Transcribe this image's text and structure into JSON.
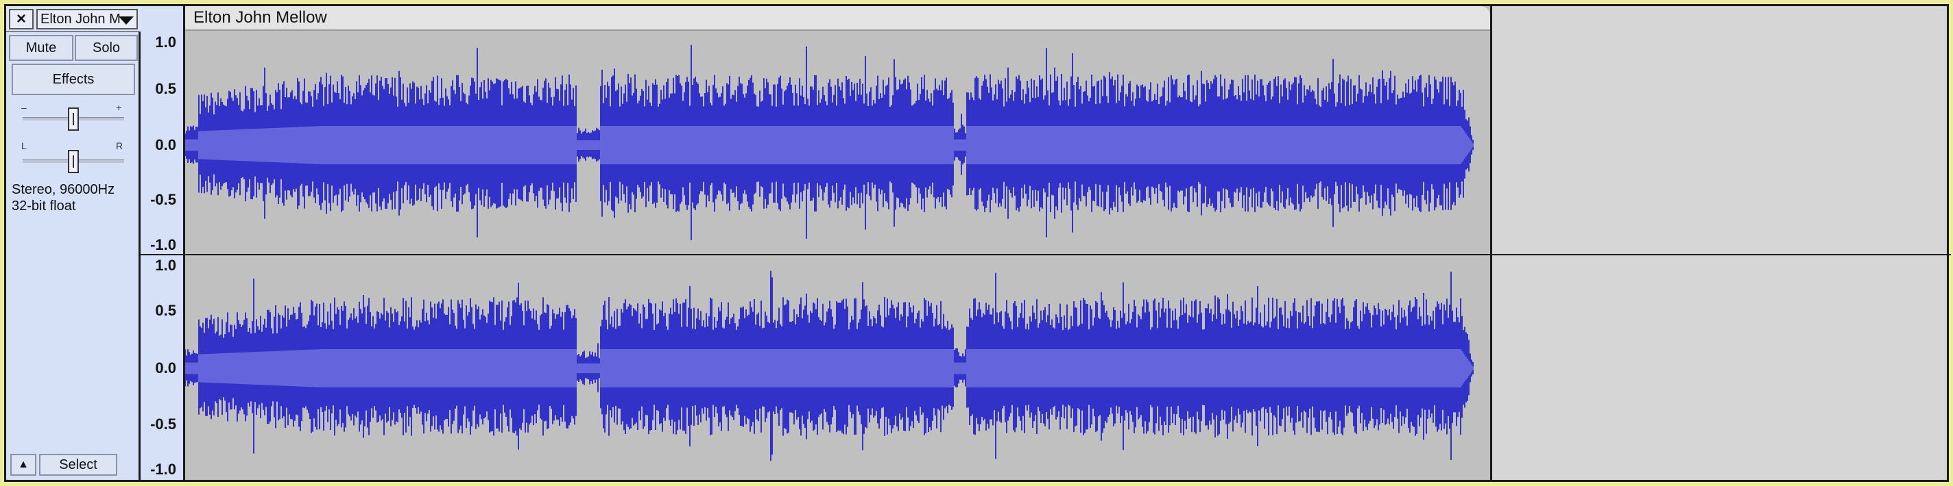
{
  "track": {
    "name": "Elton John M",
    "clip_title": "Elton John Mellow",
    "mute_label": "Mute",
    "solo_label": "Solo",
    "effects_label": "Effects",
    "gain_minus": "–",
    "gain_plus": "+",
    "pan_left": "L",
    "pan_right": "R",
    "format_line1": "Stereo, 96000Hz",
    "format_line2": "32-bit float",
    "select_label": "Select",
    "close_icon": "×",
    "collapse_icon": "▲"
  },
  "ruler": {
    "top_channel": [
      "1.0",
      "0.5",
      "0.0",
      "-0.5",
      "-1.0"
    ],
    "bottom_channel": [
      "1.0",
      "0.5",
      "0.0",
      "-0.5",
      "-1.0"
    ]
  },
  "colors": {
    "waveform_peak": "#3232c8",
    "waveform_rms": "#6464dc",
    "clip_bg": "#c0c0c0",
    "control_bg": "#d6e0f6",
    "border_highlight": "#ecec9e"
  }
}
